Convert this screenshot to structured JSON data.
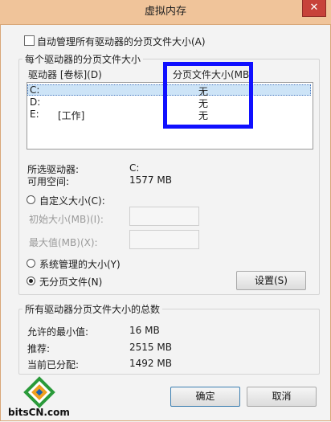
{
  "window": {
    "title": "虚拟内存",
    "close_glyph": "✕"
  },
  "auto_manage": {
    "label": "自动管理所有驱动器的分页文件大小(A)",
    "checked": false
  },
  "drives_group": {
    "title": "每个驱动器的分页文件大小",
    "col_drive": "驱动器 [卷标](D)",
    "col_size": "分页文件大小(MB",
    "rows": [
      {
        "drive": "C:",
        "label": "",
        "size": "无",
        "selected": true
      },
      {
        "drive": "D:",
        "label": "",
        "size": "无",
        "selected": false
      },
      {
        "drive": "E:",
        "label": "[工作]",
        "size": "无",
        "selected": false
      }
    ],
    "selected_drive_label": "所选驱动器:",
    "selected_drive_value": "C:",
    "free_space_label": "可用空间:",
    "free_space_value": "1577 MB",
    "custom_size_label": "自定义大小(C):",
    "initial_size_label": "初始大小(MB)(I):",
    "max_size_label": "最大值(MB)(X):",
    "system_managed_label": "系统管理的大小(Y)",
    "no_paging_label": "无分页文件(N)",
    "selected_option": "no_paging",
    "set_button": "设置(S)"
  },
  "totals_group": {
    "title": "所有驱动器分页文件大小的总数",
    "min_label": "允许的最小值:",
    "min_value": "16 MB",
    "recommended_label": "推荐:",
    "recommended_value": "2515 MB",
    "allocated_label": "当前已分配:",
    "allocated_value": "1492 MB"
  },
  "footer": {
    "ok_button": "确定",
    "cancel_button": "取消"
  },
  "watermark": {
    "site": "bitsCN.com"
  },
  "colors": {
    "titlebar": "#f0c49a",
    "highlight": "#1010ff",
    "close": "#c7423a",
    "selection": "#cde4f7"
  }
}
